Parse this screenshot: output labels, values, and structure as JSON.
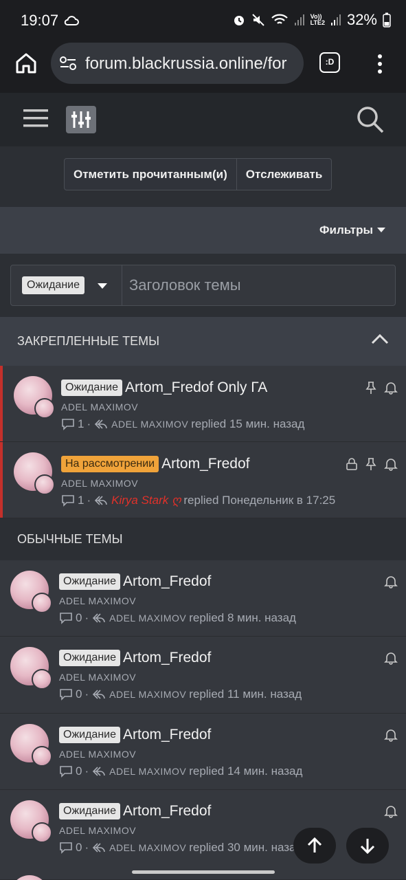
{
  "status_bar": {
    "time": "19:07",
    "lte": "Vo))\nLTE2",
    "battery": "32%"
  },
  "browser": {
    "url": "forum.blackrussia.online/for",
    "tab_label": ":D"
  },
  "actions": {
    "mark_read": "Отметить прочитанным(и)",
    "watch": "Отслеживать"
  },
  "filters": {
    "label": "Фильтры"
  },
  "search": {
    "prefix": "Ожидание",
    "placeholder": "Заголовок темы"
  },
  "pinned_section": {
    "title": "ЗАКРЕПЛЕННЫЕ ТЕМЫ"
  },
  "normal_section": {
    "title": "ОБЫЧНЫЕ ТЕМЫ"
  },
  "pinned_threads": [
    {
      "prefix": "Ожидание",
      "title": "Artom_Fredof Only ГА",
      "author": "ADEL MAXIMOV",
      "replies": "1",
      "last_user": "ADEL MAXIMOV",
      "last_action": "replied 15 мин. назад"
    },
    {
      "prefix": "На рассмотрении",
      "title": "Artom_Fredof",
      "author": "ADEL MAXIMOV",
      "replies": "1",
      "last_user": "Kirya Stark ღ",
      "last_action": "replied Понедельник в 17:25"
    }
  ],
  "threads": [
    {
      "prefix": "Ожидание",
      "title": "Artom_Fredof",
      "author": "ADEL MAXIMOV",
      "replies": "0",
      "last_user": "ADEL MAXIMOV",
      "last_action": "replied 8 мин. назад"
    },
    {
      "prefix": "Ожидание",
      "title": "Artom_Fredof",
      "author": "ADEL MAXIMOV",
      "replies": "0",
      "last_user": "ADEL MAXIMOV",
      "last_action": "replied 11 мин. назад"
    },
    {
      "prefix": "Ожидание",
      "title": "Artom_Fredof",
      "author": "ADEL MAXIMOV",
      "replies": "0",
      "last_user": "ADEL MAXIMOV",
      "last_action": "replied 14 мин. назад"
    },
    {
      "prefix": "Ожидание",
      "title": "Artom_Fredof",
      "author": "ADEL MAXIMOV",
      "replies": "0",
      "last_user": "ADEL MAXIMOV",
      "last_action": "replied 30 мин. наза"
    }
  ],
  "colors": {
    "pinned_accent": "#c4302b",
    "review_tag": "#f0a33a",
    "wait_tag": "#e6e6e6"
  }
}
